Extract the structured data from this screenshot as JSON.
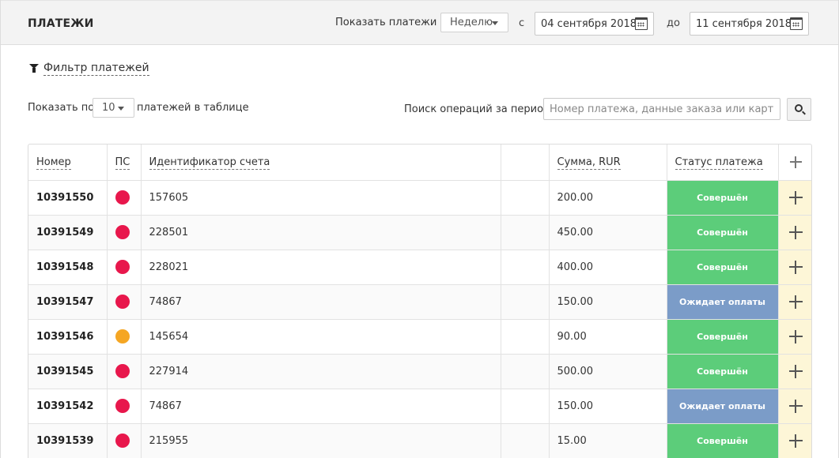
{
  "header": {
    "title": "ПЛАТЕЖИ",
    "period_label": "Показать платежи за:",
    "period_value": "Неделю",
    "from_label": "с",
    "from_date": "04 сентября 2018",
    "to_label": "до",
    "to_date": "11 сентября 2018"
  },
  "filter": {
    "label": "Фильтр платежей"
  },
  "pagination": {
    "label": "Показать по:",
    "value": "10",
    "suffix": "платежей в таблице"
  },
  "search": {
    "label": "Поиск операций за период:",
    "placeholder": "Номер платежа, данные заказа или карты"
  },
  "table": {
    "columns": {
      "number": "Номер",
      "ps": "ПС",
      "account_id": "Идентификатор счета",
      "amount": "Сумма, RUR",
      "status": "Статус платежа"
    },
    "rows": [
      {
        "number": "10391550",
        "ps_color": "#e8174c",
        "account_id": "157605",
        "amount": "200.00",
        "status": "Совершён",
        "status_color": "#5ccd7a"
      },
      {
        "number": "10391549",
        "ps_color": "#e8174c",
        "account_id": "228501",
        "amount": "450.00",
        "status": "Совершён",
        "status_color": "#5ccd7a"
      },
      {
        "number": "10391548",
        "ps_color": "#e8174c",
        "account_id": "228021",
        "amount": "400.00",
        "status": "Совершён",
        "status_color": "#5ccd7a"
      },
      {
        "number": "10391547",
        "ps_color": "#e8174c",
        "account_id": "74867",
        "amount": "150.00",
        "status": "Ожидает оплаты",
        "status_color": "#7b9cc8"
      },
      {
        "number": "10391546",
        "ps_color": "#f5a623",
        "account_id": "145654",
        "amount": "90.00",
        "status": "Совершён",
        "status_color": "#5ccd7a"
      },
      {
        "number": "10391545",
        "ps_color": "#e8174c",
        "account_id": "227914",
        "amount": "500.00",
        "status": "Совершён",
        "status_color": "#5ccd7a"
      },
      {
        "number": "10391542",
        "ps_color": "#e8174c",
        "account_id": "74867",
        "amount": "150.00",
        "status": "Ожидает оплаты",
        "status_color": "#7b9cc8"
      },
      {
        "number": "10391539",
        "ps_color": "#e8174c",
        "account_id": "215955",
        "amount": "15.00",
        "status": "Совершён",
        "status_color": "#5ccd7a"
      }
    ]
  }
}
